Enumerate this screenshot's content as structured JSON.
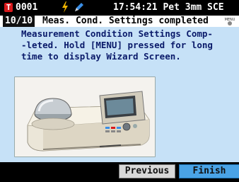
{
  "status_bar": {
    "sample_number": "0001",
    "datetime_info": "17:54:21 Pet 3mm SCE",
    "colors": {
      "t_badge": "#d8191c",
      "battery": "#f0b400",
      "pen": "#3a8ee6"
    }
  },
  "wizard": {
    "step": "10/10",
    "title": "Meas. Cond. Settings completed",
    "menu_icon_label": "MENU"
  },
  "message": {
    "line1": "Measurement Condition Settings Comp-",
    "line2": "-leted. Hold [MENU] pressed for long",
    "line3": "time to display Wizard Screen."
  },
  "buttons": {
    "previous": "Previous",
    "finish": "Finish"
  },
  "icons": {
    "t": "T",
    "battery": "battery-icon",
    "pen": "pen-icon",
    "menu": "menu-icon"
  },
  "accent_color": "#4aa3e6"
}
